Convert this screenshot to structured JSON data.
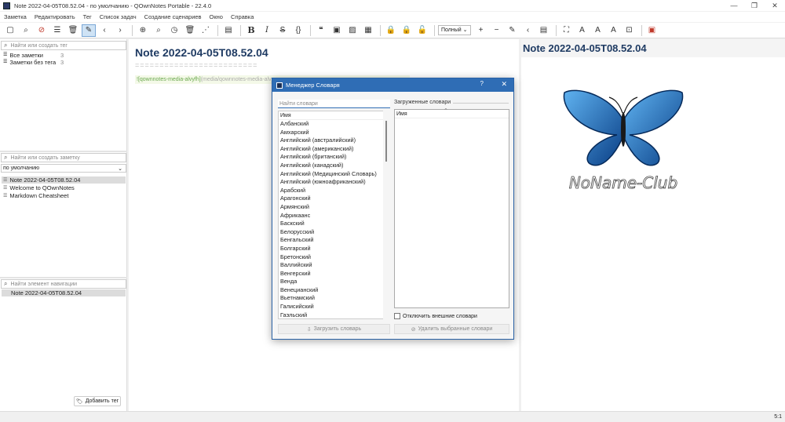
{
  "window": {
    "title": "Note 2022-04-05T08.52.04 - по умолчанию - QOwnNotes Portable - 22.4.0",
    "controls": [
      "—",
      "❐",
      "✕"
    ]
  },
  "menu": [
    "Заметка",
    "Редактировать",
    "Тег",
    "Список задач",
    "Создание сценариев",
    "Окно",
    "Справка"
  ],
  "toolbar": {
    "mode_combo": "Полный"
  },
  "left": {
    "tag_search_placeholder": "Найти или создать тег",
    "tags": [
      {
        "label": "Все заметки",
        "count": "3"
      },
      {
        "label": "Заметки без тега",
        "count": "3"
      }
    ],
    "note_search_placeholder": "Найти или создать заметку",
    "folder_value": "по умолчанию",
    "notes": [
      "Note 2022-04-05T08.52.04",
      "Welcome to QOwnNotes",
      "Markdown Cheatsheet"
    ],
    "nav_search_placeholder": "Найти элемент навигации",
    "nav_items": [
      "Note 2022-04-05T08.52.04"
    ],
    "add_tag_label": "Добавить тег"
  },
  "editor": {
    "heading": "Note 2022-04-05T08.52.04",
    "underline": "=========================",
    "media_text": "![qownnotes-media-alvyfh]",
    "media_path": "(media/qownnotes-media-alvy"
  },
  "preview": {
    "heading": "Note 2022-04-05T08.52.04",
    "logo_text": "NoName-Club"
  },
  "status": {
    "position": "5:1"
  },
  "dialog": {
    "title": "Менеджер Словаря",
    "help": "?",
    "close": "✕",
    "search_placeholder": "Найти словари",
    "left_header": "Имя",
    "dictionaries": [
      "Албанский",
      "Амхарский",
      "Английский (австралийский)",
      "Английский (американский)",
      "Английский (британский)",
      "Английский (канадский)",
      "Английский (Медицинский Словарь)",
      "Английский (южноафриканский)",
      "Арабский",
      "Арагонский",
      "Армянский",
      "Африкаанс",
      "Баскский",
      "Белорусский",
      "Бенгальский",
      "Болгарский",
      "Бретонский",
      "Валлийский",
      "Венгерский",
      "Венда",
      "Венецианский",
      "Вьетнамский",
      "Галисийский",
      "Гаэльский"
    ],
    "loaded_label": "Загруженные словари",
    "right_header": "Имя",
    "disable_external_label": "Отключить внешние словари",
    "download_button": "Загрузить словарь",
    "delete_button": "Удалить выбранные словари"
  }
}
